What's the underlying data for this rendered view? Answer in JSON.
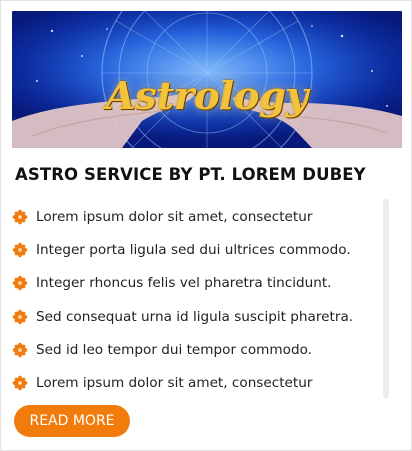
{
  "banner": {
    "word": "Astrology",
    "colors": {
      "sky_center": "#3f8cf0",
      "sky_edge": "#07197a",
      "lettering": "#f3c43b"
    }
  },
  "title": "ASTRO SERVICE BY PT. LOREM DUBEY",
  "bullet_icon": "orange-flower-icon",
  "items": [
    {
      "text": "Lorem ipsum dolor sit amet, consectetur"
    },
    {
      "text": "Integer porta ligula sed dui ultrices commodo."
    },
    {
      "text": "Integer rhoncus felis vel pharetra tincidunt."
    },
    {
      "text": "Sed consequat urna id ligula suscipit pharetra."
    },
    {
      "text": "Sed id leo tempor dui tempor commodo."
    },
    {
      "text": "Lorem ipsum dolor sit amet, consectetur"
    }
  ],
  "read_more_label": "READ MORE",
  "colors": {
    "accent": "#f17c0b",
    "title": "#111111",
    "text": "#222222"
  }
}
